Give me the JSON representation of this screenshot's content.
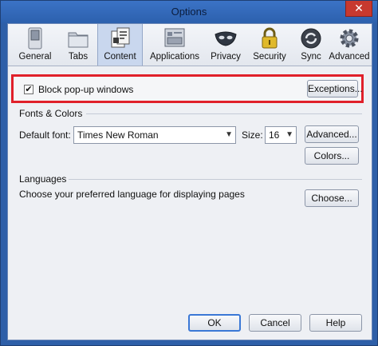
{
  "window": {
    "title": "Options",
    "close_glyph": "✕"
  },
  "toolbar": {
    "items": [
      {
        "label": "General",
        "icon": "switch-icon"
      },
      {
        "label": "Tabs",
        "icon": "folder-tabs-icon"
      },
      {
        "label": "Content",
        "icon": "document-icon",
        "active": true
      },
      {
        "label": "Applications",
        "icon": "applications-icon"
      },
      {
        "label": "Privacy",
        "icon": "mask-icon"
      },
      {
        "label": "Security",
        "icon": "lock-icon"
      },
      {
        "label": "Sync",
        "icon": "sync-icon"
      },
      {
        "label": "Advanced",
        "icon": "gear-icon"
      }
    ]
  },
  "popups": {
    "checkbox_label": "Block pop-up windows",
    "checked": true,
    "check_glyph": "✔",
    "exceptions_button": "Exceptions..."
  },
  "fonts": {
    "section_label": "Fonts & Colors",
    "default_font_label": "Default font:",
    "default_font_value": "Times New Roman",
    "size_label": "Size:",
    "size_value": "16",
    "advanced_button": "Advanced...",
    "colors_button": "Colors..."
  },
  "languages": {
    "section_label": "Languages",
    "description": "Choose your preferred language for displaying pages",
    "choose_button": "Choose..."
  },
  "footer": {
    "ok_button": "OK",
    "cancel_button": "Cancel",
    "help_button": "Help"
  },
  "colors": {
    "highlight_border": "#e0202a",
    "title_bar": "#2e5fa8",
    "active_tab": "#c9d7ee"
  }
}
